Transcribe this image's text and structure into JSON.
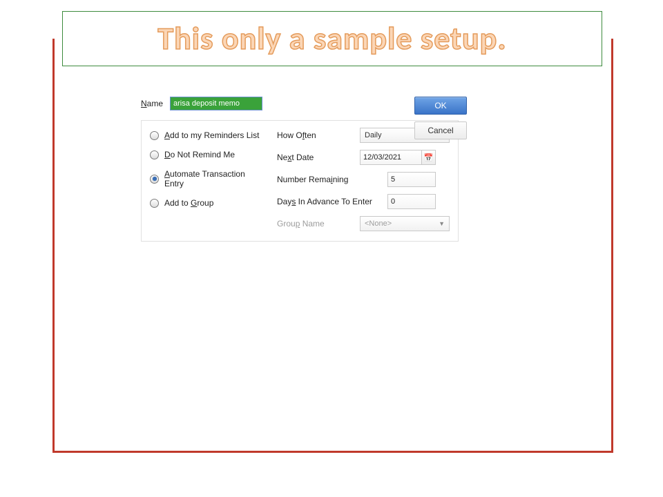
{
  "banner": "This only a sample setup.",
  "labels": {
    "name_prefix": "N",
    "name_rest": "ame",
    "how_often_prefix": "How O",
    "how_often_u": "f",
    "how_often_rest": "ten",
    "next_date_prefix": "Ne",
    "next_date_u": "x",
    "next_date_rest": "t Date",
    "number_remaining_prefix": "Number Rema",
    "number_remaining_u": "i",
    "number_remaining_rest": "ning",
    "days_advance_prefix": "Day",
    "days_advance_u": "s",
    "days_advance_rest": " In Advance To Enter",
    "group_name_prefix": "Grou",
    "group_name_u": "p",
    "group_name_rest": " Name"
  },
  "name_value": "arisa deposit memo",
  "radios": [
    {
      "u": "A",
      "rest": "dd to my Reminders List",
      "checked": false
    },
    {
      "pre": "",
      "u": "D",
      "rest": "o Not Remind Me",
      "checked": false
    },
    {
      "pre": "",
      "u": "A",
      "rest": "utomate Transaction Entry",
      "checked": true
    },
    {
      "pre": "Add to ",
      "u": "G",
      "rest": "roup",
      "checked": false
    }
  ],
  "how_often_value": "Daily",
  "next_date_value": "12/03/2021",
  "number_remaining_value": "5",
  "days_advance_value": "0",
  "group_name_value": "<None>",
  "buttons": {
    "ok": "OK",
    "cancel": "Cancel"
  }
}
